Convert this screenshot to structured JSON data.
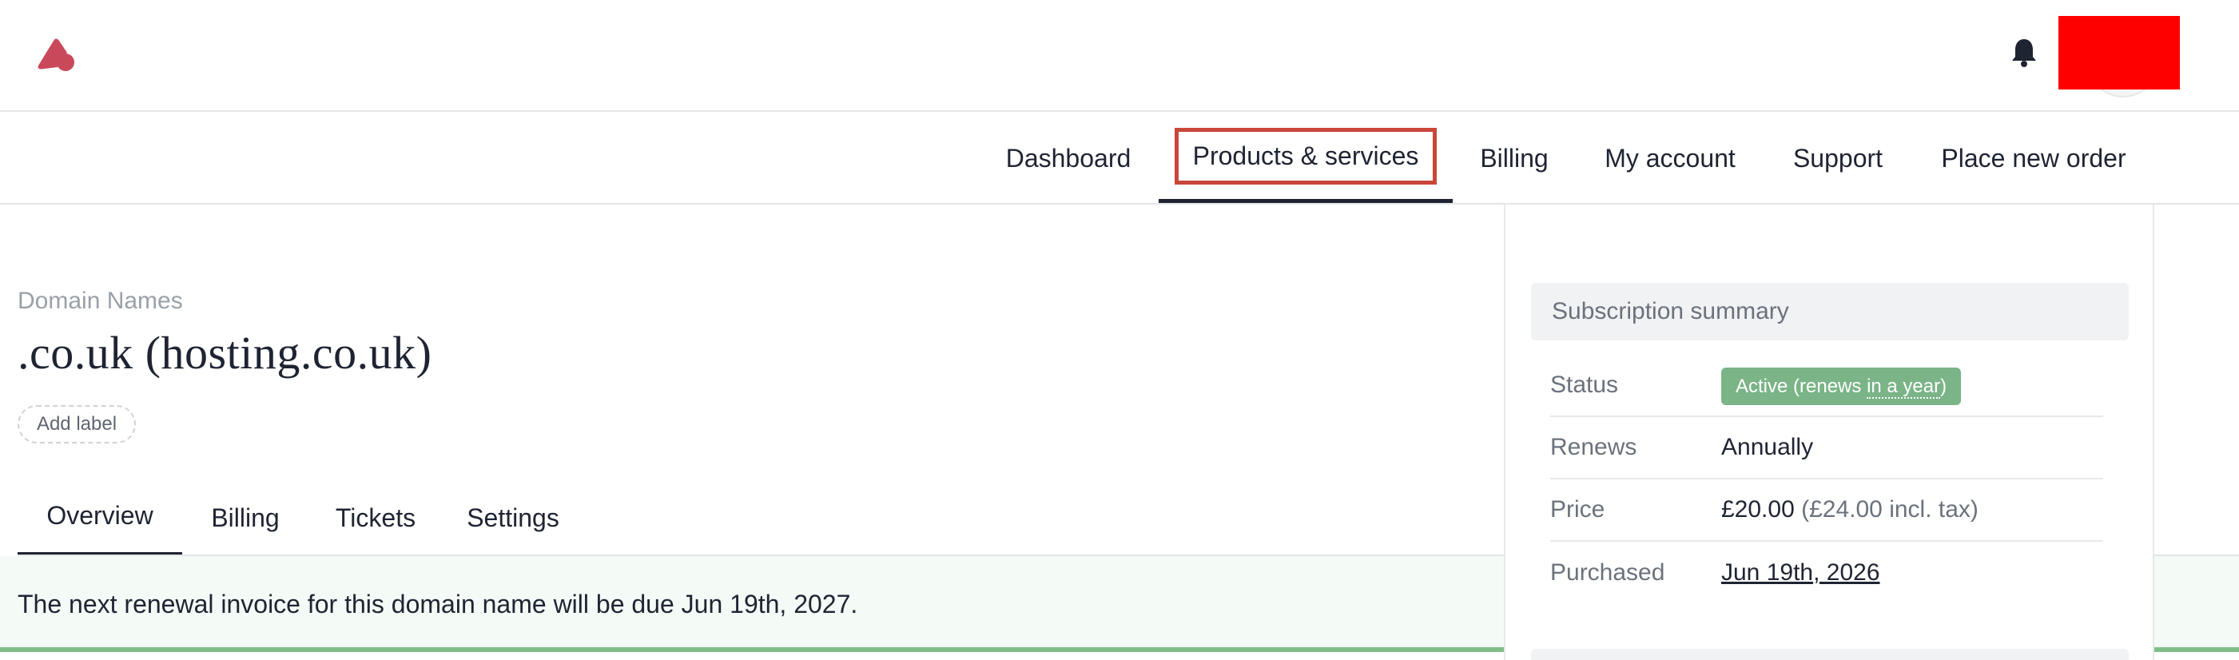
{
  "colors": {
    "brand": "#c9495a",
    "highlight_box": "#c9473a",
    "status_badge": "#7ab487",
    "notice_border": "#7fbd87",
    "redaction": "#ff0000"
  },
  "header": {
    "logo_icon": "brand-logo-icon",
    "notifications_icon": "bell-icon",
    "avatar": "user-avatar (redacted)"
  },
  "nav": {
    "items": [
      {
        "label": "Dashboard"
      },
      {
        "label": "Products & services",
        "active": true
      },
      {
        "label": "Billing"
      },
      {
        "label": "My account"
      },
      {
        "label": "Support"
      },
      {
        "label": "Place new order"
      }
    ]
  },
  "product": {
    "category": "Domain Names",
    "title": ".co.uk (hosting.co.uk)",
    "add_label": "Add label"
  },
  "tabs": [
    {
      "label": "Overview",
      "active": true
    },
    {
      "label": "Billing"
    },
    {
      "label": "Tickets"
    },
    {
      "label": "Settings"
    }
  ],
  "notice": {
    "text": "The next renewal invoice for this domain name will be due Jun 19th, 2027."
  },
  "summary": {
    "title": "Subscription summary",
    "status_label": "Status",
    "status_prefix": "Active (renews ",
    "status_relative": "in a year",
    "status_suffix": ")",
    "renews_label": "Renews",
    "renews_value": "Annually",
    "price_label": "Price",
    "price_value": "£20.00",
    "price_incl_tax": "(£24.00 incl. tax)",
    "purchased_label": "Purchased",
    "purchased_value": "Jun 19th, 2026"
  }
}
